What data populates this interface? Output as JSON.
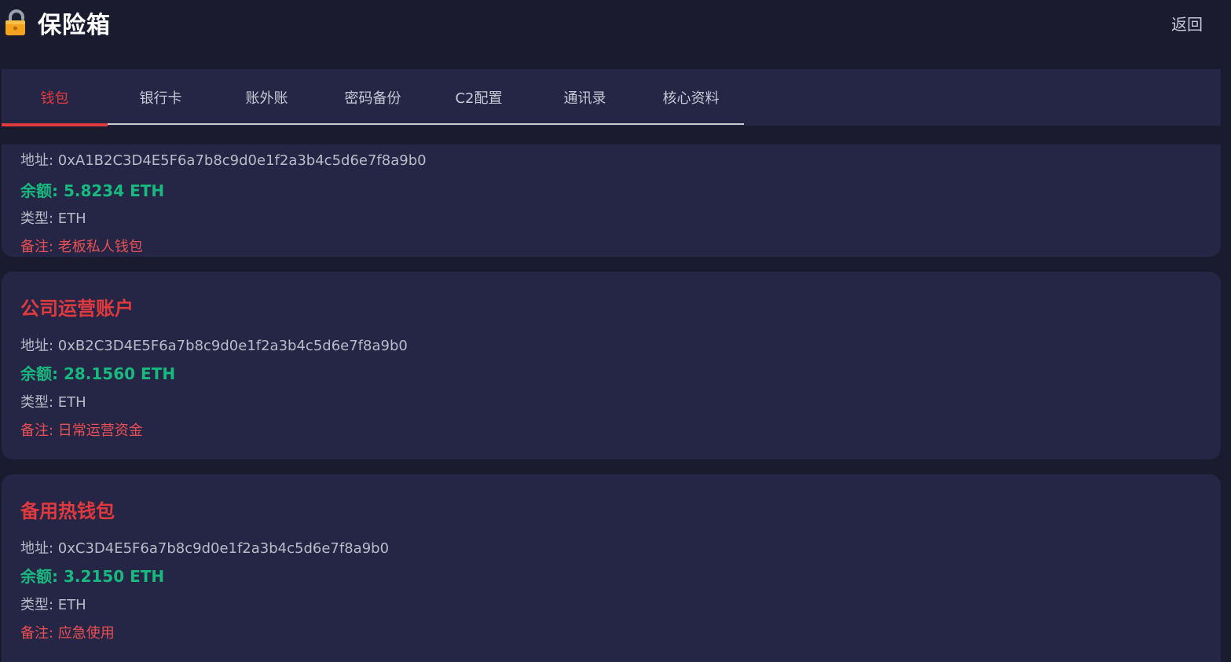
{
  "header": {
    "title": "保险箱",
    "icon": "lock-icon",
    "back_label": "返回"
  },
  "tabs": [
    {
      "label": "钱包",
      "active": true
    },
    {
      "label": "银行卡",
      "active": false
    },
    {
      "label": "账外账",
      "active": false
    },
    {
      "label": "密码备份",
      "active": false
    },
    {
      "label": "C2配置",
      "active": false
    },
    {
      "label": "通讯录",
      "active": false
    },
    {
      "label": "核心资料",
      "active": false
    }
  ],
  "wallets": [
    {
      "name": "",
      "address": "地址: 0xA1B2C3D4E5F6a7b8c9d0e1f2a3b4c5d6e7f8a9b0",
      "balance": "余额: 5.8234 ETH",
      "type": "类型: ETH",
      "note": "备注: 老板私人钱包"
    },
    {
      "name": "公司运营账户",
      "address": "地址: 0xB2C3D4E5F6a7b8c9d0e1f2a3b4c5d6e7f8a9b0",
      "balance": "余额: 28.1560 ETH",
      "type": "类型: ETH",
      "note": "备注: 日常运营资金"
    },
    {
      "name": "备用热钱包",
      "address": "地址: 0xC3D4E5F6a7b8c9d0e1f2a3b4c5d6e7f8a9b0",
      "balance": "余额: 3.2150 ETH",
      "type": "类型: ETH",
      "note": "备注: 应急使用"
    }
  ],
  "colors": {
    "background": "#1a1b2e",
    "card": "#252645",
    "accent_red": "#e0393e",
    "balance_green": "#18b97f"
  }
}
